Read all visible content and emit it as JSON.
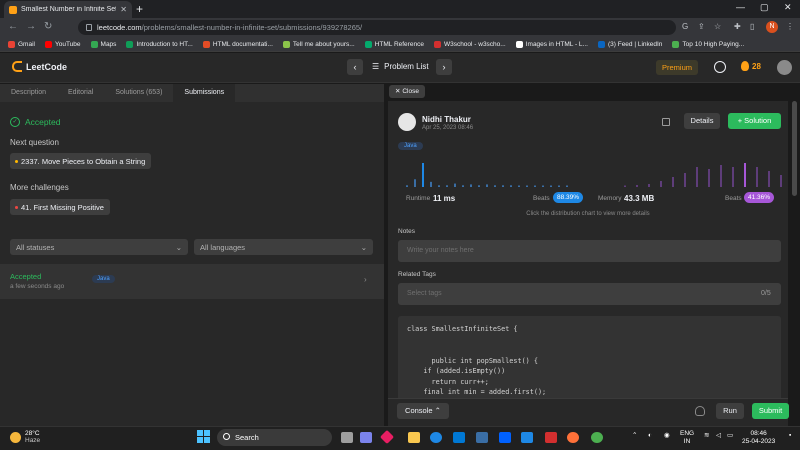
{
  "browser": {
    "tab_title": "Smallest Number in Infinite Set -",
    "url_host": "leetcode.com",
    "url_path": "/problems/smallest-number-in-infinite-set/submissions/939278265/",
    "profile_initial": "N",
    "bookmarks": [
      {
        "label": "Gmail",
        "color": "#ea4335"
      },
      {
        "label": "YouTube",
        "color": "#ff0000"
      },
      {
        "label": "Maps",
        "color": "#34a853"
      },
      {
        "label": "Introduction to HT...",
        "color": "#0f9d58"
      },
      {
        "label": "HTML documentati...",
        "color": "#e34c26"
      },
      {
        "label": "Tell me about yours...",
        "color": "#8bc34a"
      },
      {
        "label": "HTML Reference",
        "color": "#04aa6d"
      },
      {
        "label": "W3school - w3scho...",
        "color": "#d32f2f"
      },
      {
        "label": "Images in HTML - L...",
        "color": "#ffffff"
      },
      {
        "label": "(3) Feed | LinkedIn",
        "color": "#0a66c2"
      },
      {
        "label": "Top 10 High Paying...",
        "color": "#4caf50"
      }
    ]
  },
  "nav": {
    "logo": "LeetCode",
    "problem_list": "Problem List",
    "premium": "Premium",
    "streak": "28"
  },
  "left": {
    "tabs": [
      "Description",
      "Editorial",
      "Solutions (653)",
      "Submissions"
    ],
    "status": "Accepted",
    "next_question_label": "Next question",
    "next_question": "2337. Move Pieces to Obtain a String",
    "more_challenges_label": "More challenges",
    "more_challenge": "41. First Missing Positive",
    "filter_status": "All statuses",
    "filter_language": "All languages",
    "submission": {
      "status": "Accepted",
      "time": "a few seconds ago",
      "lang": "Java"
    }
  },
  "right": {
    "close": "Close",
    "user_name": "Nidhi Thakur",
    "date": "Apr 25, 2023 08:46",
    "details": "Details",
    "solution": "+ Solution",
    "lang_tag": "Java",
    "runtime_label": "Runtime",
    "runtime_value": "11 ms",
    "runtime_beats_label": "Beats",
    "runtime_beats": "88.39%",
    "memory_label": "Memory",
    "memory_value": "43.3 MB",
    "memory_beats_label": "Beats",
    "memory_beats": "41.36%",
    "hint": "Click the distribution chart to view more details",
    "notes_label": "Notes",
    "notes_placeholder": "Write your notes here",
    "tags_label": "Related Tags",
    "tags_placeholder": "Select tags",
    "tags_count": "0/5",
    "code_lines": [
      "class SmallestInfiniteSet {",
      "",
      "",
      "      public int popSmallest() {",
      "    if (added.isEmpty())",
      "      return curr++;",
      "    final int min = added.first();"
    ],
    "runtime_bars": [
      2,
      9,
      28,
      6,
      2,
      2,
      4,
      2,
      3,
      2,
      3,
      2,
      2,
      2,
      1,
      1,
      1,
      1,
      1,
      1,
      1
    ],
    "memory_bars": [
      1,
      2,
      3,
      6,
      10,
      14,
      20,
      18,
      22,
      20,
      24,
      20,
      16,
      12
    ],
    "colors": {
      "runtime": "#1e88e5",
      "runtime_beats": "#1e88e5",
      "memory": "#7e57c2",
      "memory_beats": "#a757d8",
      "accent_green": "#2cbb5d"
    }
  },
  "bottom": {
    "console": "Console",
    "run": "Run",
    "submit": "Submit"
  },
  "taskbar": {
    "temp": "28°C",
    "condition": "Haze",
    "search": "Search",
    "lang": "ENG",
    "region": "IN",
    "time": "08:46",
    "date": "25-04-2023"
  }
}
